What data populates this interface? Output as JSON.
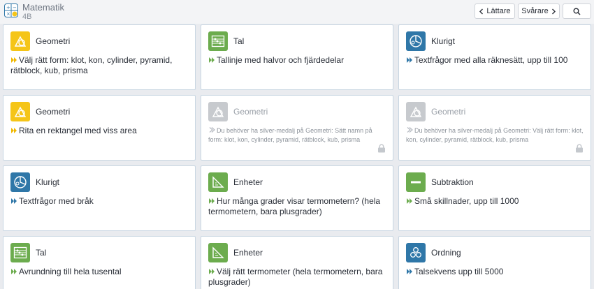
{
  "header": {
    "title": "Matematik",
    "subtitle": "4B",
    "easier_label": "Lättare",
    "harder_label": "Svårare",
    "search_icon": "search-icon"
  },
  "colors": {
    "geometri": "#f5c518",
    "tal": "#6cac4e",
    "klurigt": "#2f77a8",
    "enheter": "#6cac4e",
    "subtraktion": "#6cac4e",
    "ordning": "#2f77a8",
    "locked": "#c7cace",
    "chevron_yellow": "#f0b800",
    "chevron_blue": "#2f77a8"
  },
  "cards": [
    {
      "title": "Geometri",
      "desc": "Välj rätt form: klot, kon, cylinder, pyramid, rätblock, kub, prisma",
      "icon": "geometry-icon",
      "chev": "yellow"
    },
    {
      "title": "Tal",
      "desc": "Tallinje med halvor och fjärdedelar",
      "icon": "abacus-icon",
      "chev": "green"
    },
    {
      "title": "Klurigt",
      "desc": "Textfrågor med alla räknesätt, upp till 100",
      "icon": "puzzle-icon",
      "chev": "blue"
    },
    {
      "title": "Geometri",
      "desc": "Rita en rektangel med viss area",
      "icon": "geometry-icon",
      "chev": "yellow"
    },
    {
      "title": "Geometri",
      "desc": "Du behöver ha silver-medalj på Geometri: Sätt namn på form: klot, kon, cylinder, pyramid, rätblock, kub, prisma",
      "icon": "geometry-icon",
      "locked": true
    },
    {
      "title": "Geometri",
      "desc": "Du behöver ha silver-medalj på Geometri: Välj rätt form: klot, kon, cylinder, pyramid, rätblock, kub, prisma",
      "icon": "geometry-icon",
      "locked": true
    },
    {
      "title": "Klurigt",
      "desc": "Textfrågor med bråk",
      "icon": "puzzle-icon",
      "chev": "blue"
    },
    {
      "title": "Enheter",
      "desc": "Hur många grader visar termometern? (hela termometern, bara plusgrader)",
      "icon": "ruler-icon",
      "chev": "green"
    },
    {
      "title": "Subtraktion",
      "desc": "Små skillnader, upp till 1000",
      "icon": "minus-icon",
      "chev": "green"
    },
    {
      "title": "Tal",
      "desc": "Avrundning till hela tusental",
      "icon": "abacus-icon",
      "chev": "green"
    },
    {
      "title": "Enheter",
      "desc": "Välj rätt termometer (hela termometern, bara plusgrader)",
      "icon": "ruler-icon",
      "chev": "green"
    },
    {
      "title": "Ordning",
      "desc": "Talsekvens upp till 5000",
      "icon": "hexagons-icon",
      "chev": "blue"
    }
  ]
}
